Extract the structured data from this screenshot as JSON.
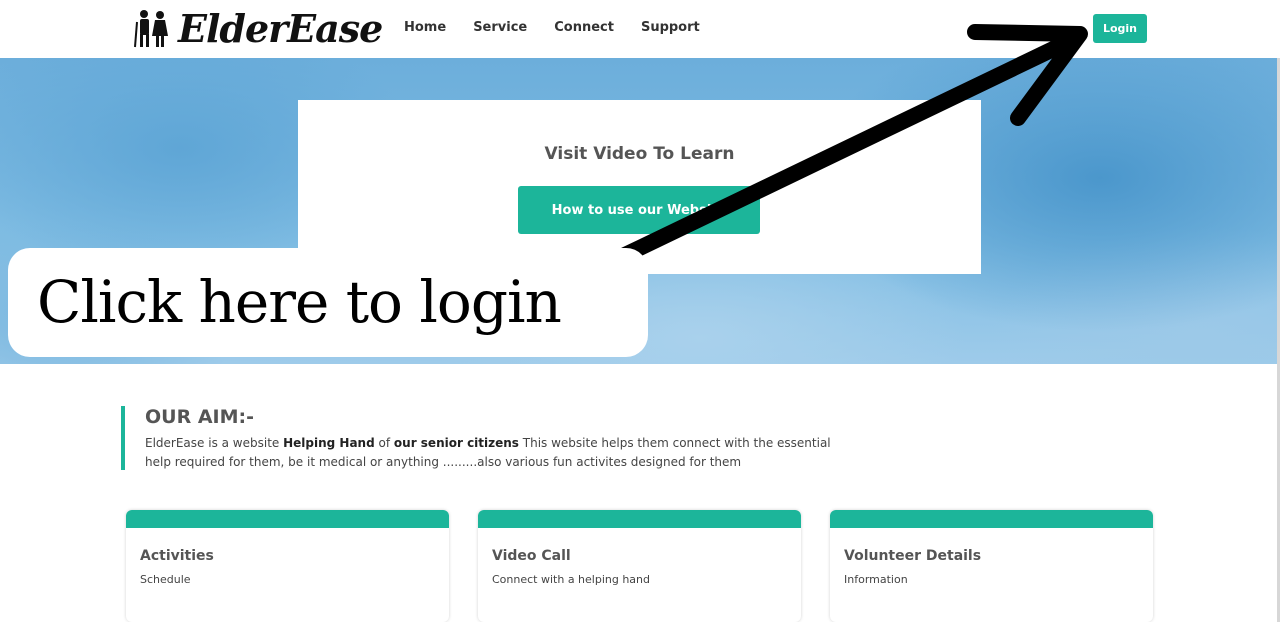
{
  "header": {
    "brand": "ElderEase",
    "nav": [
      {
        "label": "Home"
      },
      {
        "label": "Service"
      },
      {
        "label": "Connect"
      },
      {
        "label": "Support"
      }
    ],
    "login_label": "Login"
  },
  "hero": {
    "title": "Visit Video To Learn",
    "button_label": "How to use our Website"
  },
  "annotation": {
    "text": "Click here to login"
  },
  "aim": {
    "title": "OUR AIM:-",
    "text_1": "ElderEase is a website ",
    "bold_1": "Helping Hand",
    "text_2": " of ",
    "bold_2": "our senior citizens",
    "text_3": " This website helps them connect with the essential help required for them, be it medical or anything .........also various fun activites designed for them"
  },
  "cards": [
    {
      "title": "Activities",
      "subtitle": "Schedule"
    },
    {
      "title": "Video Call",
      "subtitle": "Connect with a helping hand"
    },
    {
      "title": "Volunteer Details",
      "subtitle": "Information"
    }
  ],
  "colors": {
    "accent": "#1cb59a",
    "hero_blue": "#6caedb"
  }
}
